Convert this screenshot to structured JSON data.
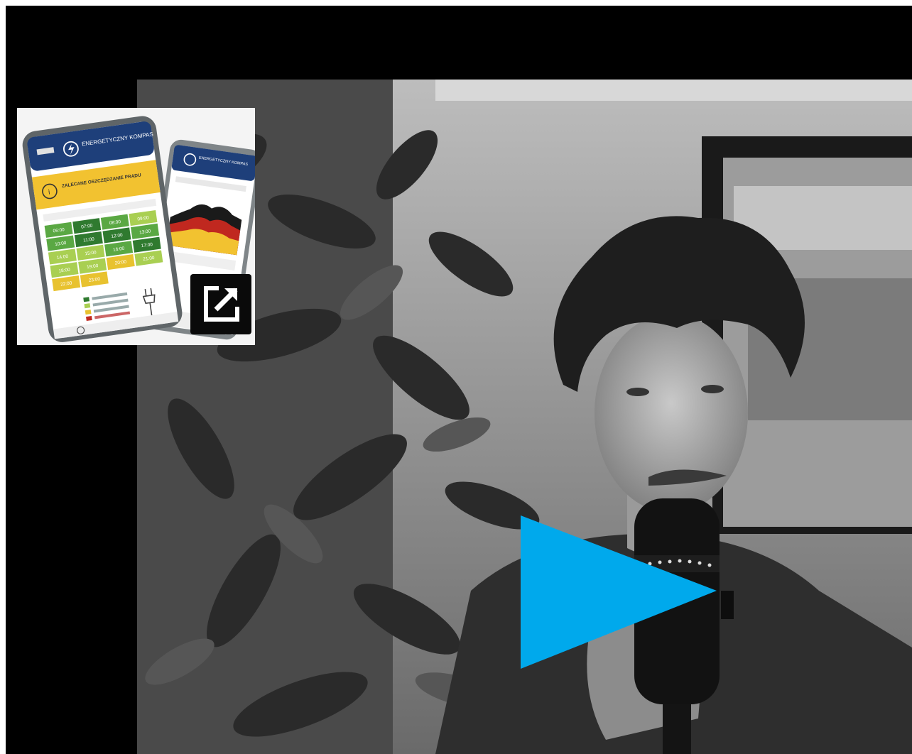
{
  "colors": {
    "letterbox": "#000000",
    "play_accent": "#00a9ec",
    "phone_header": "#1e3f7a",
    "banner_yellow": "#f2c230",
    "grid_green_dark": "#2f7a2f",
    "grid_green": "#5aa843",
    "grid_green_light": "#a9cf52",
    "grid_yellow": "#e8c22f",
    "external_link_bg": "#0a0a0a"
  },
  "icons": {
    "play": "play-triangle-icon",
    "external_link": "external-link-icon",
    "lightning": "lightning-icon",
    "info": "info-icon",
    "plug": "plug-icon",
    "clock": "clock-icon"
  },
  "thumbnail": {
    "phone_front": {
      "app_name": "ENERGETYCZNY KOMPAS",
      "banner_text": "ZALECANE OSZCZĘDZANIE PRĄDU",
      "grid_times": [
        "06:00",
        "07:00",
        "08:00",
        "09:00",
        "10:00",
        "11:00",
        "12:00",
        "13:00",
        "14:00",
        "15:00",
        "16:00",
        "17:00",
        "18:00",
        "19:00",
        "20:00",
        "21:00",
        "22:00",
        "23:00"
      ]
    },
    "phone_back": {
      "app_name": "ENERGETYCZNY KOMPAS"
    }
  }
}
